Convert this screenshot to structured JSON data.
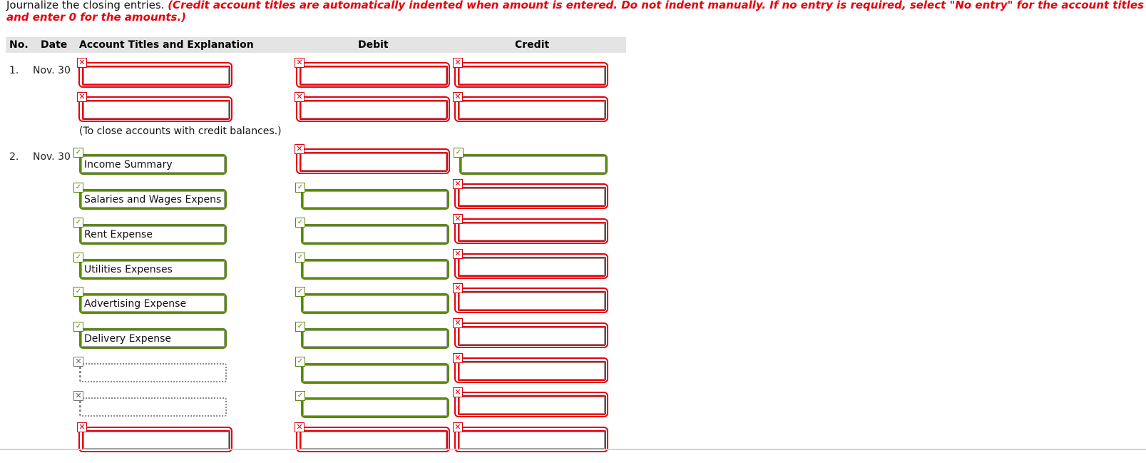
{
  "instructions": {
    "lead": "Journalize the closing entries. ",
    "note": "(Credit account titles are automatically indented when amount is entered. Do not indent manually. If no entry is required, select \"No entry\" for the account titles and enter 0 for the amounts.)"
  },
  "table": {
    "headers": {
      "no": "No.",
      "date": "Date",
      "account": "Account Titles and Explanation",
      "debit": "Debit",
      "credit": "Credit"
    }
  },
  "entries": [
    {
      "no": "1.",
      "date": "Nov. 30",
      "explanation": "(To close accounts with credit balances.)",
      "lines": [
        {
          "account": "",
          "account_status": "incorrect",
          "debit": "",
          "debit_status": "incorrect",
          "credit": "",
          "credit_status": "incorrect"
        },
        {
          "account": "",
          "account_status": "incorrect",
          "debit": "",
          "debit_status": "incorrect",
          "credit": "",
          "credit_status": "incorrect"
        }
      ]
    },
    {
      "no": "2.",
      "date": "Nov. 30",
      "lines": [
        {
          "account": "Income Summary",
          "account_status": "correct",
          "debit": "",
          "debit_status": "incorrect",
          "credit": "",
          "credit_status": "correct"
        },
        {
          "account": "Salaries and Wages Expense",
          "account_status": "correct",
          "debit": "",
          "debit_status": "correct",
          "credit": "",
          "credit_status": "incorrect"
        },
        {
          "account": "Rent Expense",
          "account_status": "correct",
          "debit": "",
          "debit_status": "correct",
          "credit": "",
          "credit_status": "incorrect"
        },
        {
          "account": "Utilities Expenses",
          "account_status": "correct",
          "debit": "",
          "debit_status": "correct",
          "credit": "",
          "credit_status": "incorrect"
        },
        {
          "account": "Advertising Expense",
          "account_status": "correct",
          "debit": "",
          "debit_status": "correct",
          "credit": "",
          "credit_status": "incorrect"
        },
        {
          "account": "Delivery Expense",
          "account_status": "correct",
          "debit": "",
          "debit_status": "correct",
          "credit": "",
          "credit_status": "incorrect"
        },
        {
          "account": "",
          "account_status": "blank",
          "debit": "",
          "debit_status": "correct",
          "credit": "",
          "credit_status": "incorrect"
        },
        {
          "account": "",
          "account_status": "blank",
          "debit": "",
          "debit_status": "correct",
          "credit": "",
          "credit_status": "incorrect"
        },
        {
          "account": "",
          "account_status": "incorrect",
          "debit": "",
          "debit_status": "incorrect",
          "credit": "",
          "credit_status": "incorrect"
        }
      ]
    }
  ],
  "status_icons": {
    "correct": "check-icon",
    "incorrect": "x-icon",
    "blank": "x-icon"
  },
  "colors": {
    "incorrect": "#e3000f",
    "correct": "#5a8a0d",
    "blank": "#8a8a8a",
    "note": "#e8000b",
    "header_bg": "#e4e4e4"
  }
}
